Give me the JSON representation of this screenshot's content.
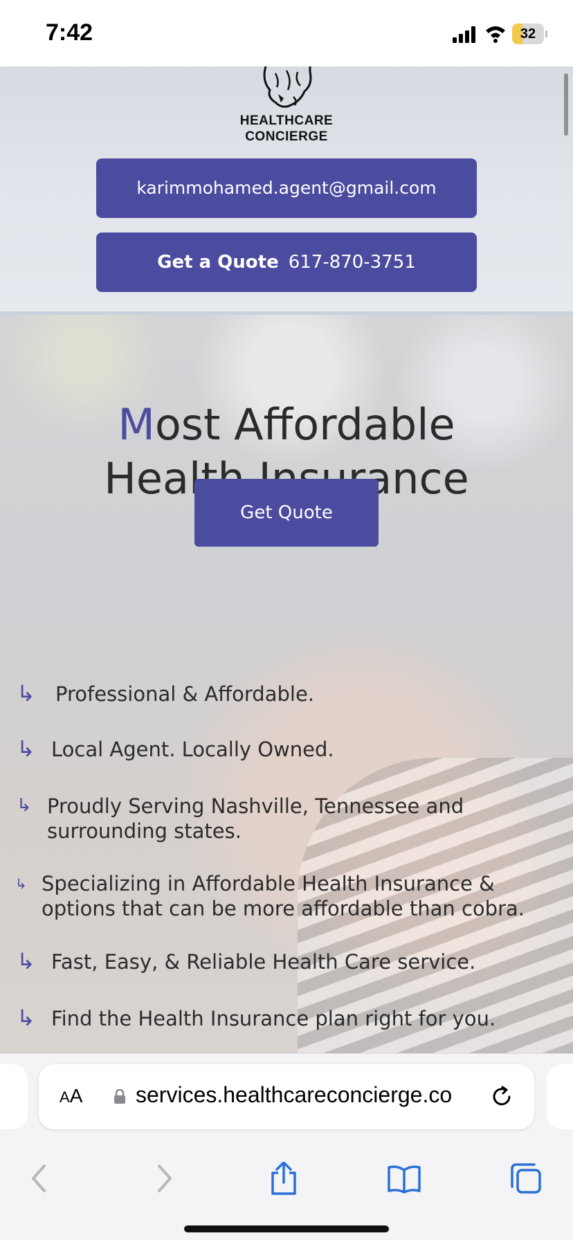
{
  "status_bar": {
    "time": "7:42",
    "battery": "32",
    "battery_level": 0.32,
    "battery_color": "#f2c94c"
  },
  "header": {
    "logo_line1": "HEALTHCARE",
    "logo_line2": "CONCIERGE",
    "email_button": "karimmohamed.agent@gmail.com",
    "quote_button_label": "Get a Quote",
    "quote_button_phone": "617-870-3751",
    "accent_color": "#4b4b9f"
  },
  "hero": {
    "title_initial": "M",
    "title_rest_line1": "ost Affordable",
    "title_line2": "Health Insurance",
    "cta_button": "Get Quote"
  },
  "features": [
    {
      "text": "Professional & Affordable.",
      "icon": "arrow-right-icon"
    },
    {
      "text": "Local Agent. Locally Owned.",
      "icon": "arrow-right-icon"
    },
    {
      "text_line1": "Proudly Serving Nashville, Tennessee and",
      "text_line2": "surrounding states.",
      "icon": "arrow-right-icon"
    },
    {
      "text_line1": "Specializing in Affordable Health Insurance &",
      "text_line2": "options that can be more affordable than cobra.",
      "icon": "arrow-right-icon"
    },
    {
      "text": "Fast, Easy, & Reliable Health Care service.",
      "icon": "arrow-right-icon"
    },
    {
      "text": "Find the Health Insurance plan right for you.",
      "icon": "arrow-right-icon"
    }
  ],
  "browser": {
    "aa_label_small": "A",
    "aa_label_big": "A",
    "url": "services.healthcareconcierge.co",
    "toolbar": [
      "back-icon",
      "forward-icon",
      "share-icon",
      "bookmarks-icon",
      "tabs-icon"
    ]
  }
}
